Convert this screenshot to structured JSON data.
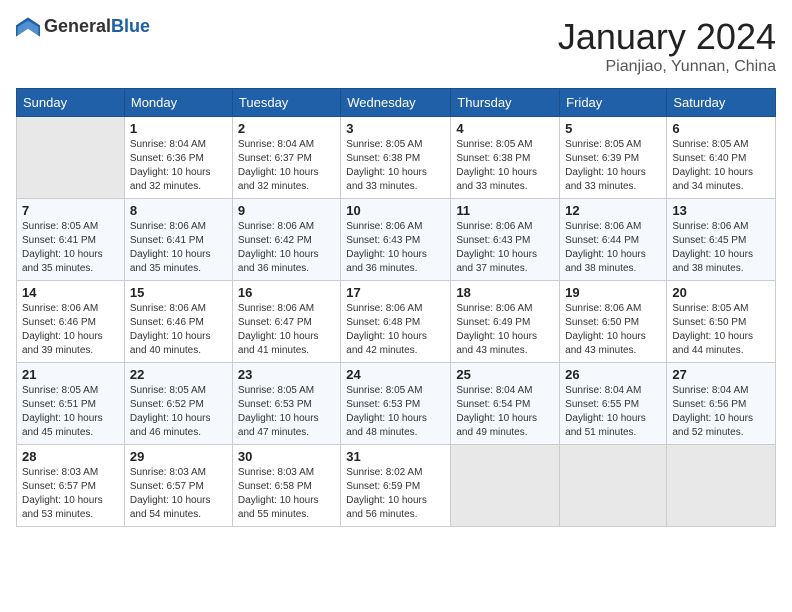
{
  "header": {
    "logo_general": "General",
    "logo_blue": "Blue",
    "title": "January 2024",
    "location": "Pianjiao, Yunnan, China"
  },
  "weekdays": [
    "Sunday",
    "Monday",
    "Tuesday",
    "Wednesday",
    "Thursday",
    "Friday",
    "Saturday"
  ],
  "weeks": [
    [
      {
        "day": "",
        "sunrise": "",
        "sunset": "",
        "daylight": "",
        "empty": true
      },
      {
        "day": "1",
        "sunrise": "8:04 AM",
        "sunset": "6:36 PM",
        "daylight": "10 hours and 32 minutes."
      },
      {
        "day": "2",
        "sunrise": "8:04 AM",
        "sunset": "6:37 PM",
        "daylight": "10 hours and 32 minutes."
      },
      {
        "day": "3",
        "sunrise": "8:05 AM",
        "sunset": "6:38 PM",
        "daylight": "10 hours and 33 minutes."
      },
      {
        "day": "4",
        "sunrise": "8:05 AM",
        "sunset": "6:38 PM",
        "daylight": "10 hours and 33 minutes."
      },
      {
        "day": "5",
        "sunrise": "8:05 AM",
        "sunset": "6:39 PM",
        "daylight": "10 hours and 33 minutes."
      },
      {
        "day": "6",
        "sunrise": "8:05 AM",
        "sunset": "6:40 PM",
        "daylight": "10 hours and 34 minutes."
      }
    ],
    [
      {
        "day": "7",
        "sunrise": "8:05 AM",
        "sunset": "6:41 PM",
        "daylight": "10 hours and 35 minutes."
      },
      {
        "day": "8",
        "sunrise": "8:06 AM",
        "sunset": "6:41 PM",
        "daylight": "10 hours and 35 minutes."
      },
      {
        "day": "9",
        "sunrise": "8:06 AM",
        "sunset": "6:42 PM",
        "daylight": "10 hours and 36 minutes."
      },
      {
        "day": "10",
        "sunrise": "8:06 AM",
        "sunset": "6:43 PM",
        "daylight": "10 hours and 36 minutes."
      },
      {
        "day": "11",
        "sunrise": "8:06 AM",
        "sunset": "6:43 PM",
        "daylight": "10 hours and 37 minutes."
      },
      {
        "day": "12",
        "sunrise": "8:06 AM",
        "sunset": "6:44 PM",
        "daylight": "10 hours and 38 minutes."
      },
      {
        "day": "13",
        "sunrise": "8:06 AM",
        "sunset": "6:45 PM",
        "daylight": "10 hours and 38 minutes."
      }
    ],
    [
      {
        "day": "14",
        "sunrise": "8:06 AM",
        "sunset": "6:46 PM",
        "daylight": "10 hours and 39 minutes."
      },
      {
        "day": "15",
        "sunrise": "8:06 AM",
        "sunset": "6:46 PM",
        "daylight": "10 hours and 40 minutes."
      },
      {
        "day": "16",
        "sunrise": "8:06 AM",
        "sunset": "6:47 PM",
        "daylight": "10 hours and 41 minutes."
      },
      {
        "day": "17",
        "sunrise": "8:06 AM",
        "sunset": "6:48 PM",
        "daylight": "10 hours and 42 minutes."
      },
      {
        "day": "18",
        "sunrise": "8:06 AM",
        "sunset": "6:49 PM",
        "daylight": "10 hours and 43 minutes."
      },
      {
        "day": "19",
        "sunrise": "8:06 AM",
        "sunset": "6:50 PM",
        "daylight": "10 hours and 43 minutes."
      },
      {
        "day": "20",
        "sunrise": "8:05 AM",
        "sunset": "6:50 PM",
        "daylight": "10 hours and 44 minutes."
      }
    ],
    [
      {
        "day": "21",
        "sunrise": "8:05 AM",
        "sunset": "6:51 PM",
        "daylight": "10 hours and 45 minutes."
      },
      {
        "day": "22",
        "sunrise": "8:05 AM",
        "sunset": "6:52 PM",
        "daylight": "10 hours and 46 minutes."
      },
      {
        "day": "23",
        "sunrise": "8:05 AM",
        "sunset": "6:53 PM",
        "daylight": "10 hours and 47 minutes."
      },
      {
        "day": "24",
        "sunrise": "8:05 AM",
        "sunset": "6:53 PM",
        "daylight": "10 hours and 48 minutes."
      },
      {
        "day": "25",
        "sunrise": "8:04 AM",
        "sunset": "6:54 PM",
        "daylight": "10 hours and 49 minutes."
      },
      {
        "day": "26",
        "sunrise": "8:04 AM",
        "sunset": "6:55 PM",
        "daylight": "10 hours and 51 minutes."
      },
      {
        "day": "27",
        "sunrise": "8:04 AM",
        "sunset": "6:56 PM",
        "daylight": "10 hours and 52 minutes."
      }
    ],
    [
      {
        "day": "28",
        "sunrise": "8:03 AM",
        "sunset": "6:57 PM",
        "daylight": "10 hours and 53 minutes."
      },
      {
        "day": "29",
        "sunrise": "8:03 AM",
        "sunset": "6:57 PM",
        "daylight": "10 hours and 54 minutes."
      },
      {
        "day": "30",
        "sunrise": "8:03 AM",
        "sunset": "6:58 PM",
        "daylight": "10 hours and 55 minutes."
      },
      {
        "day": "31",
        "sunrise": "8:02 AM",
        "sunset": "6:59 PM",
        "daylight": "10 hours and 56 minutes."
      },
      {
        "day": "",
        "sunrise": "",
        "sunset": "",
        "daylight": "",
        "empty": true
      },
      {
        "day": "",
        "sunrise": "",
        "sunset": "",
        "daylight": "",
        "empty": true
      },
      {
        "day": "",
        "sunrise": "",
        "sunset": "",
        "daylight": "",
        "empty": true
      }
    ]
  ]
}
